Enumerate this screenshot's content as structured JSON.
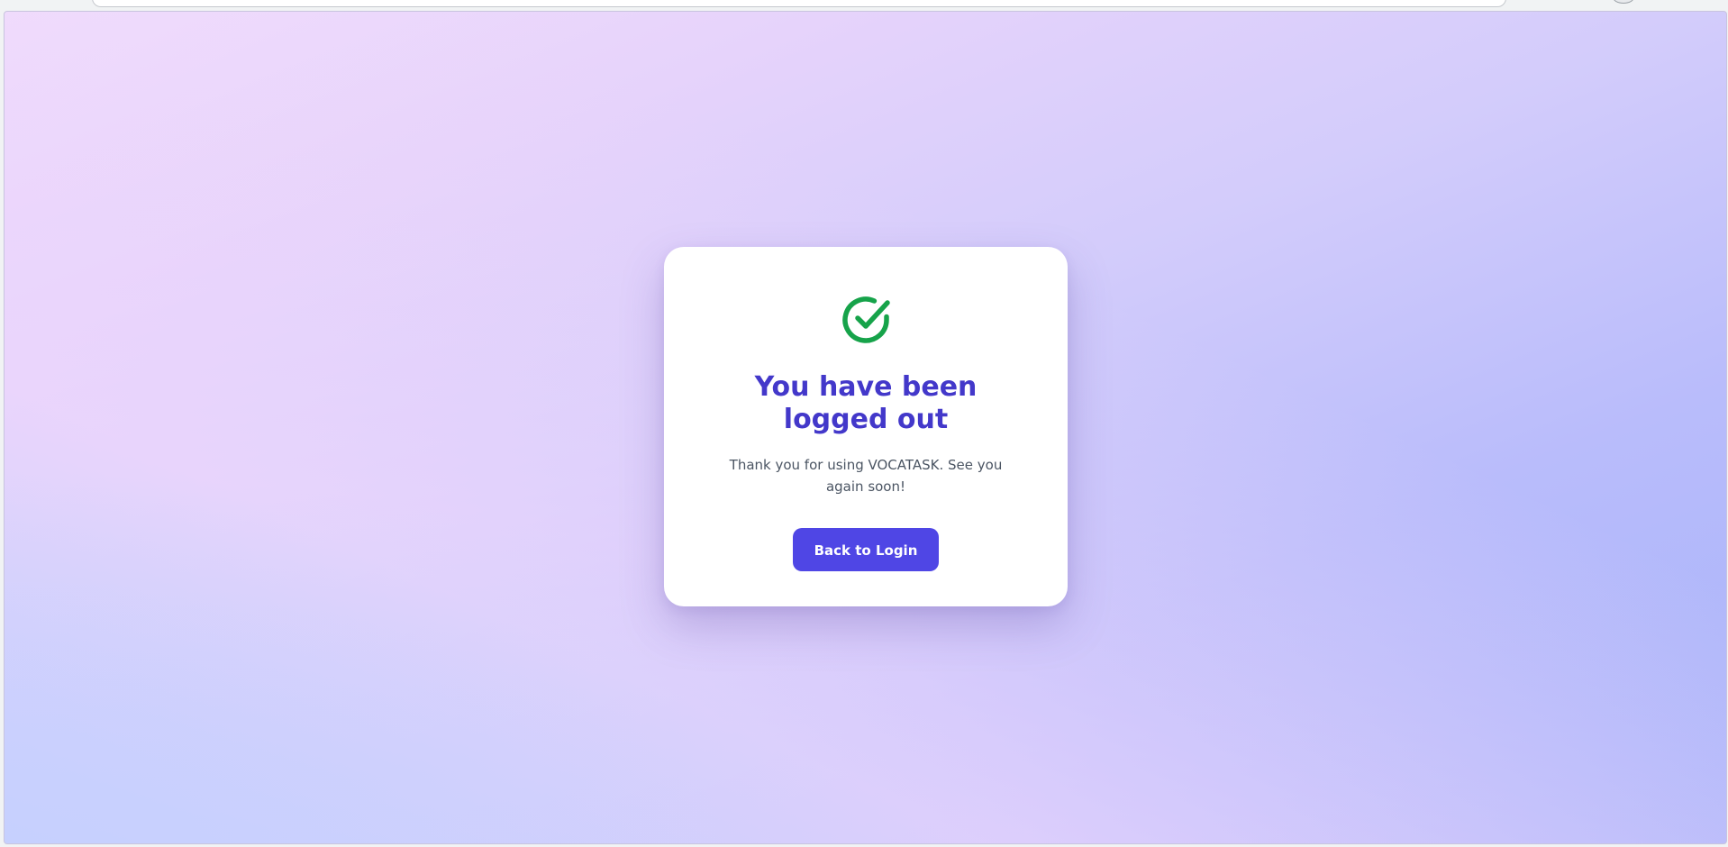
{
  "page": {
    "title": "You have been logged out",
    "message": "Thank you for using VOCATASK. See you again soon!",
    "button_label": "Back to Login",
    "status_icon": "check-circle-icon"
  },
  "colors": {
    "title": "#4338ca",
    "button": "#4f46e5",
    "success_icon": "#16a34a",
    "background_start": "#f1ddfc",
    "background_end": "#a7b3fa"
  }
}
